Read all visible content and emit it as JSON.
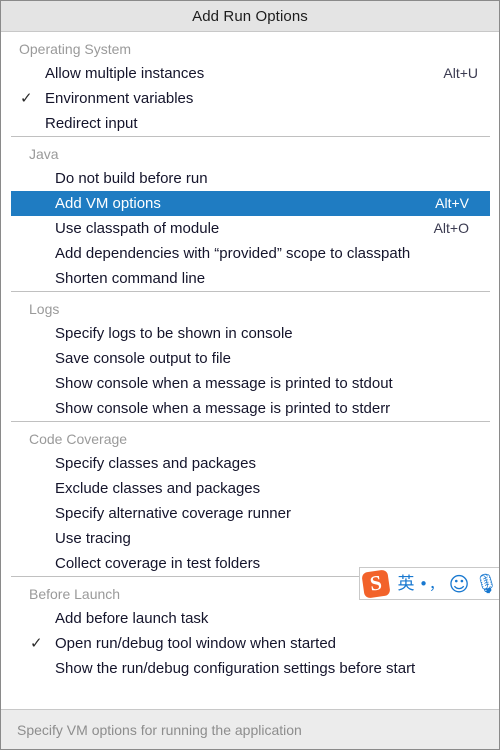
{
  "window": {
    "title": "Add Run Options",
    "accent_color": "#1f7cc2",
    "titlebar_color": "#e4e4e4"
  },
  "groups": [
    {
      "header": "Operating System",
      "items": [
        {
          "label": "Allow multiple instances",
          "shortcut": "Alt+U",
          "check": "",
          "selected": false
        },
        {
          "label": "Environment variables",
          "shortcut": "",
          "check": "✓",
          "selected": false
        },
        {
          "label": "Redirect input",
          "shortcut": "",
          "check": "",
          "selected": false
        }
      ]
    },
    {
      "header": "Java",
      "items": [
        {
          "label": "Do not build before run",
          "shortcut": "",
          "check": "",
          "selected": false
        },
        {
          "label": "Add VM options",
          "shortcut": "Alt+V",
          "check": "",
          "selected": true
        },
        {
          "label": "Use classpath of module",
          "shortcut": "Alt+O",
          "check": "",
          "selected": false
        },
        {
          "label": "Add dependencies with “provided” scope to classpath",
          "shortcut": "",
          "check": "",
          "selected": false
        },
        {
          "label": "Shorten command line",
          "shortcut": "",
          "check": "",
          "selected": false
        }
      ]
    },
    {
      "header": "Logs",
      "items": [
        {
          "label": "Specify logs to be shown in console",
          "shortcut": "",
          "check": "",
          "selected": false
        },
        {
          "label": "Save console output to file",
          "shortcut": "",
          "check": "",
          "selected": false
        },
        {
          "label": "Show console when a message is printed to stdout",
          "shortcut": "",
          "check": "",
          "selected": false
        },
        {
          "label": "Show console when a message is printed to stderr",
          "shortcut": "",
          "check": "",
          "selected": false
        }
      ]
    },
    {
      "header": "Code Coverage",
      "items": [
        {
          "label": "Specify classes and packages",
          "shortcut": "",
          "check": "",
          "selected": false
        },
        {
          "label": "Exclude classes and packages",
          "shortcut": "",
          "check": "",
          "selected": false
        },
        {
          "label": "Specify alternative coverage runner",
          "shortcut": "",
          "check": "",
          "selected": false
        },
        {
          "label": "Use tracing",
          "shortcut": "",
          "check": "",
          "selected": false
        },
        {
          "label": "Collect coverage in test folders",
          "shortcut": "",
          "check": "",
          "selected": false
        }
      ]
    },
    {
      "header": "Before Launch",
      "items": [
        {
          "label": "Add before launch task",
          "shortcut": "",
          "check": "",
          "selected": false
        },
        {
          "label": "Open run/debug tool window when started",
          "shortcut": "",
          "check": "✓",
          "selected": false
        },
        {
          "label": "Show the run/debug configuration settings before start",
          "shortcut": "",
          "check": "",
          "selected": false
        }
      ]
    }
  ],
  "statusbar": {
    "text": "Specify VM options for running the application"
  },
  "ime_bar": {
    "logo_letter": "S",
    "logo_color": "#f2622a",
    "icon_color": "#1878d0",
    "items": [
      {
        "name": "language-mode-icon",
        "glyph": "英",
        "cls": "ime-cn"
      },
      {
        "name": "punctuation-mode-icon",
        "glyph": "•，",
        "cls": "ime-punct"
      },
      {
        "name": "emoji-icon",
        "glyph": "☺",
        "cls": "ime-smiley"
      },
      {
        "name": "microphone-icon",
        "glyph": "🎙",
        "cls": "ime-mic"
      }
    ]
  }
}
